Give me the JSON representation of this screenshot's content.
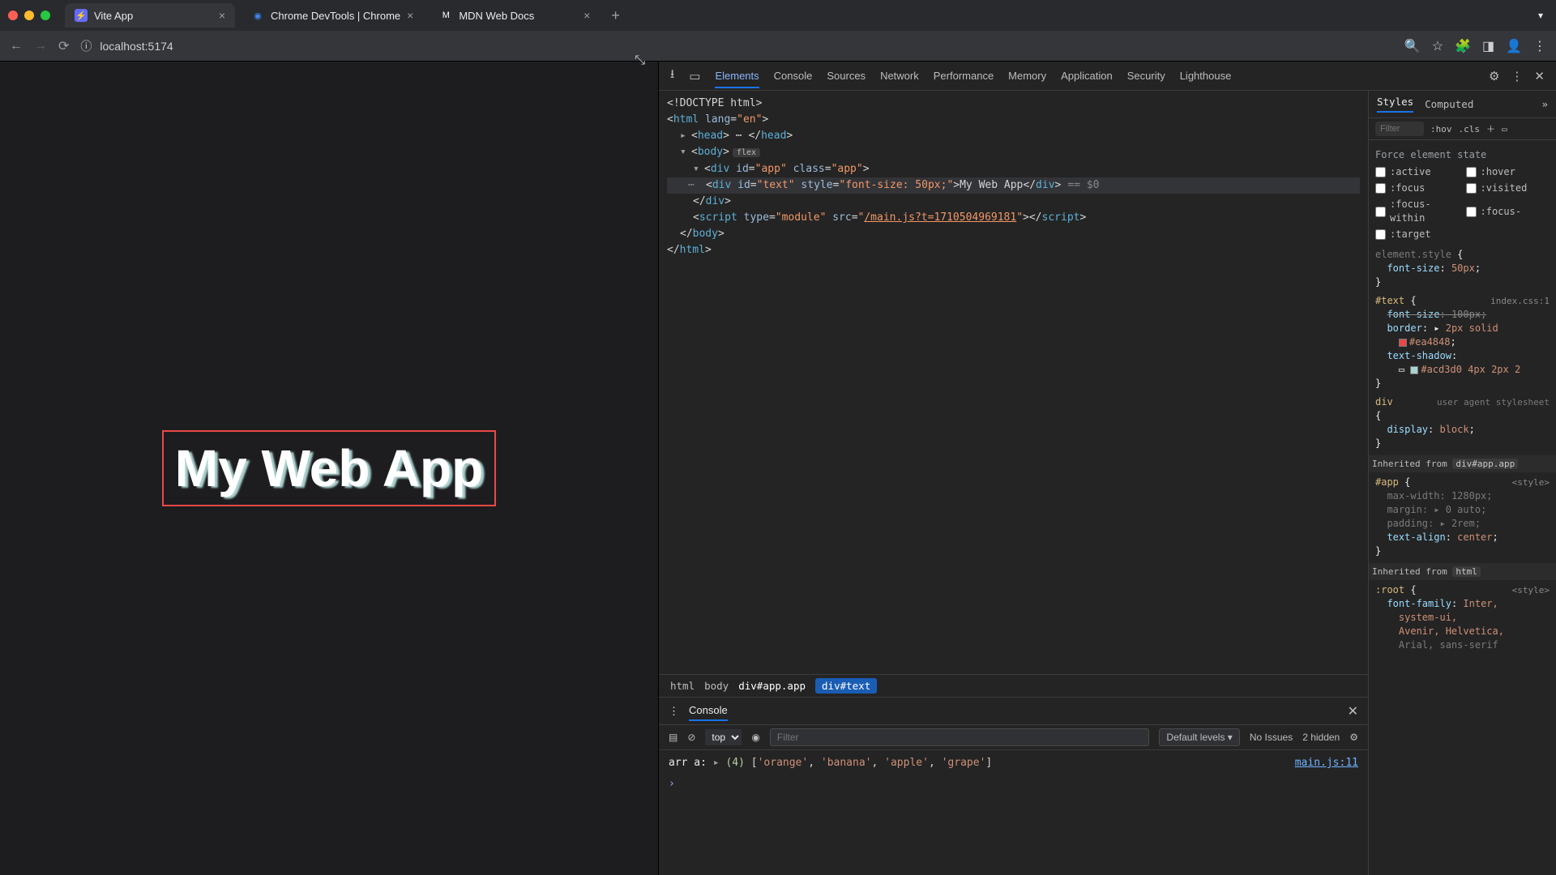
{
  "tabs": [
    {
      "title": "Vite App",
      "fav": "V",
      "favbg": "#646cff"
    },
    {
      "title": "Chrome DevTools | Chrome",
      "fav": "●",
      "favbg": "#1a73e8"
    },
    {
      "title": "MDN Web Docs",
      "fav": "M",
      "favbg": "#000"
    }
  ],
  "address": "localhost:5174",
  "page_text": "My Web App",
  "devtools": {
    "tabs": [
      "Elements",
      "Console",
      "Sources",
      "Network",
      "Performance",
      "Memory",
      "Application",
      "Security",
      "Lighthouse"
    ],
    "dom": {
      "doctype": "<!DOCTYPE html>",
      "html_open": "html",
      "lang": "en",
      "head": "head",
      "body": "body",
      "flex": "flex",
      "app_id": "app",
      "app_class": "app",
      "text_id": "text",
      "text_style": "font-size: 50px;",
      "text_content": "My Web App",
      "eq0": "== $0",
      "script_type": "module",
      "script_src": "/main.js?t=1710504969181"
    },
    "crumbs": [
      "html",
      "body",
      "div#app.app",
      "div#text"
    ],
    "styles": {
      "tabs": [
        "Styles",
        "Computed"
      ],
      "filter": "Filter",
      "hov": ":hov",
      "cls": ".cls",
      "force": "Force element state",
      "pseudo": [
        ":active",
        ":hover",
        ":focus",
        ":visited",
        ":focus-within",
        ":focus-",
        ":target"
      ],
      "elstyle_label": "element.style",
      "elstyle_prop": "font-size",
      "elstyle_val": "50px",
      "text_sel": "#text",
      "text_src": "index.css:1",
      "text_fs_prop": "font-size",
      "text_fs_val": "100px",
      "border_prop": "border",
      "border_val": "2px solid",
      "border_color": "#ea4848",
      "shadow_prop": "text-shadow",
      "shadow_color": "#acd3d0",
      "shadow_rest": "4px 2px 2",
      "div_sel": "div",
      "ua": "user agent stylesheet",
      "display_prop": "display",
      "display_val": "block",
      "inh1": "Inherited from",
      "inh1_chip": "div#app.app",
      "app_sel": "#app",
      "app_src": "<style>",
      "mw_p": "max-width",
      "mw_v": "1280px",
      "mg_p": "margin",
      "mg_v": "0 auto",
      "pd_p": "padding",
      "pd_v": "2rem",
      "ta_p": "text-align",
      "ta_v": "center",
      "inh2": "Inherited from",
      "inh2_chip": "html",
      "root_sel": ":root",
      "root_src": "<style>",
      "ff_p": "font-family",
      "ff_v1": "Inter,",
      "ff_v2": "system-ui,",
      "ff_v3": "Avenir, Helvetica,",
      "ff_v4": "Arial, sans-serif"
    },
    "console": {
      "title": "Console",
      "context": "top",
      "filter": "Filter",
      "levels": "Default levels",
      "issues": "No Issues",
      "hidden": "2 hidden",
      "log_label": "arr a:",
      "log_count": "(4)",
      "log_items": [
        "'orange'",
        "'banana'",
        "'apple'",
        "'grape'"
      ],
      "src": "main.js:11"
    }
  }
}
